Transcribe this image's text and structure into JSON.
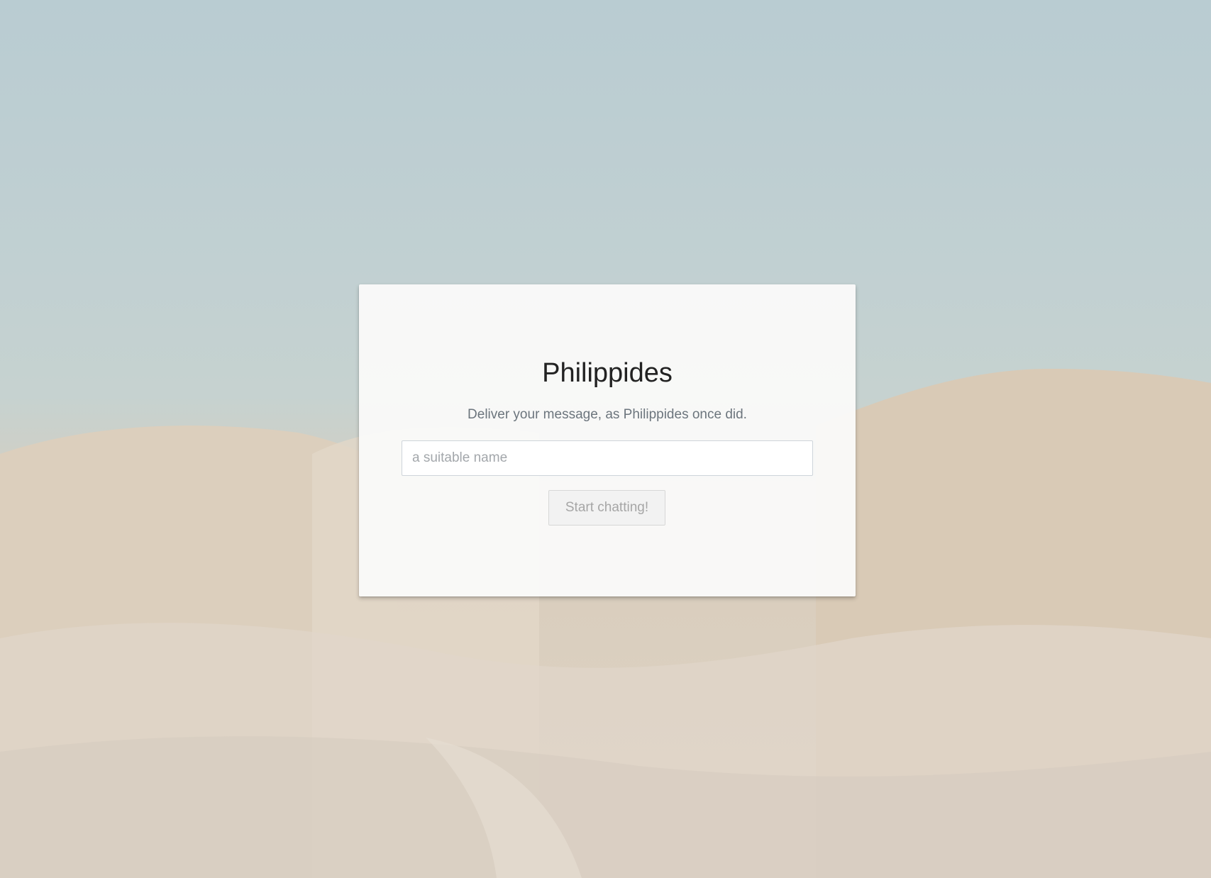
{
  "app": {
    "title": "Philippides",
    "tagline": "Deliver your message, as Philippides once did."
  },
  "login_form": {
    "name_input": {
      "value": "",
      "placeholder": "a suitable name"
    },
    "submit_label": "Start chatting!",
    "submit_disabled": true
  },
  "theme": {
    "sky_color": "#bccfd4",
    "sand_color": "#ddd0bf",
    "card_color": "#f8f8f7",
    "title_color": "#222222",
    "subtitle_color": "#6c757d",
    "button_disabled_text": "#a6a6a6"
  }
}
